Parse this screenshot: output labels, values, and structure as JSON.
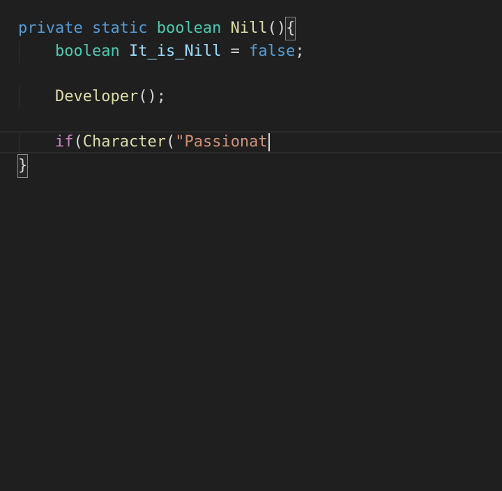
{
  "code": {
    "line1": {
      "private": "private",
      "static": "static",
      "boolean": "boolean",
      "method_name": "Nill",
      "parens": "()",
      "open_brace": "{"
    },
    "line2": {
      "type": "boolean",
      "var_name": "It_is_Nill",
      "assign": "=",
      "value": "false",
      "semicolon": ";"
    },
    "line4": {
      "call": "Developer",
      "parens_semicolon": "();"
    },
    "line6": {
      "keyword": "if",
      "open_paren": "(",
      "call": "Character",
      "open_paren2": "(",
      "string": "\"Passionat"
    },
    "line7": {
      "close_brace": "}"
    }
  },
  "colors": {
    "background": "#1f1f1f",
    "keyword_blue": "#569cd6",
    "type_teal": "#4ec9b0",
    "function_yellow": "#dcdcaa",
    "variable_lightblue": "#9cdcfe",
    "control_purple": "#c586c0",
    "string_orange": "#ce9178"
  }
}
